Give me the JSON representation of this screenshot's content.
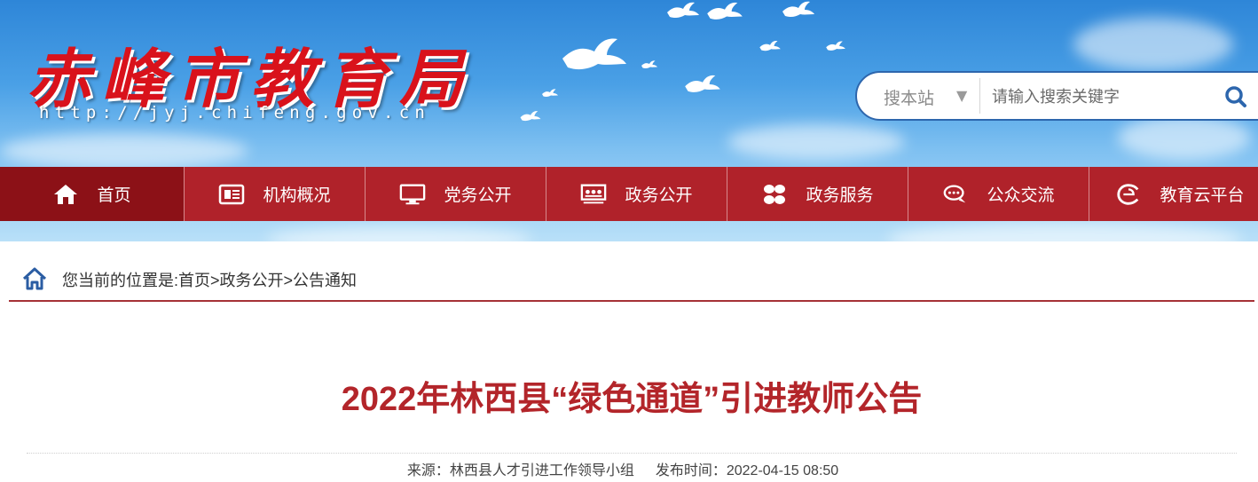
{
  "header": {
    "site_title": "赤峰市教育局",
    "site_url": "http://jyj.chifeng.gov.cn"
  },
  "search": {
    "scope_label": "搜本站",
    "scope_arrow": "▼",
    "placeholder": "请输入搜索关键字",
    "button_icon": "search-icon"
  },
  "nav": {
    "items": [
      {
        "label": "首页",
        "icon": "home-icon"
      },
      {
        "label": "机构概况",
        "icon": "newspaper-icon"
      },
      {
        "label": "党务公开",
        "icon": "monitor-icon"
      },
      {
        "label": "政务公开",
        "icon": "display-board-icon"
      },
      {
        "label": "政务服务",
        "icon": "four-dots-icon"
      },
      {
        "label": "公众交流",
        "icon": "chat-icon"
      },
      {
        "label": "教育云平台",
        "icon": "cloud-e-icon"
      }
    ]
  },
  "breadcrumb": {
    "prefix": "您当前的位置是:",
    "items": [
      "首页",
      "政务公开",
      "公告通知"
    ],
    "separator": ">"
  },
  "article": {
    "title": "2022年林西县“绿色通道”引进教师公告",
    "source_label": "来源：",
    "source": "林西县人才引进工作领导小组",
    "date_label": "发布时间：",
    "date": "2022-04-15 08:50"
  },
  "colors": {
    "nav_bg": "#b0222a",
    "nav_active": "#8c1117",
    "title_red": "#b3252a",
    "logo_red": "#d9121b",
    "search_border": "#2d66ad"
  }
}
